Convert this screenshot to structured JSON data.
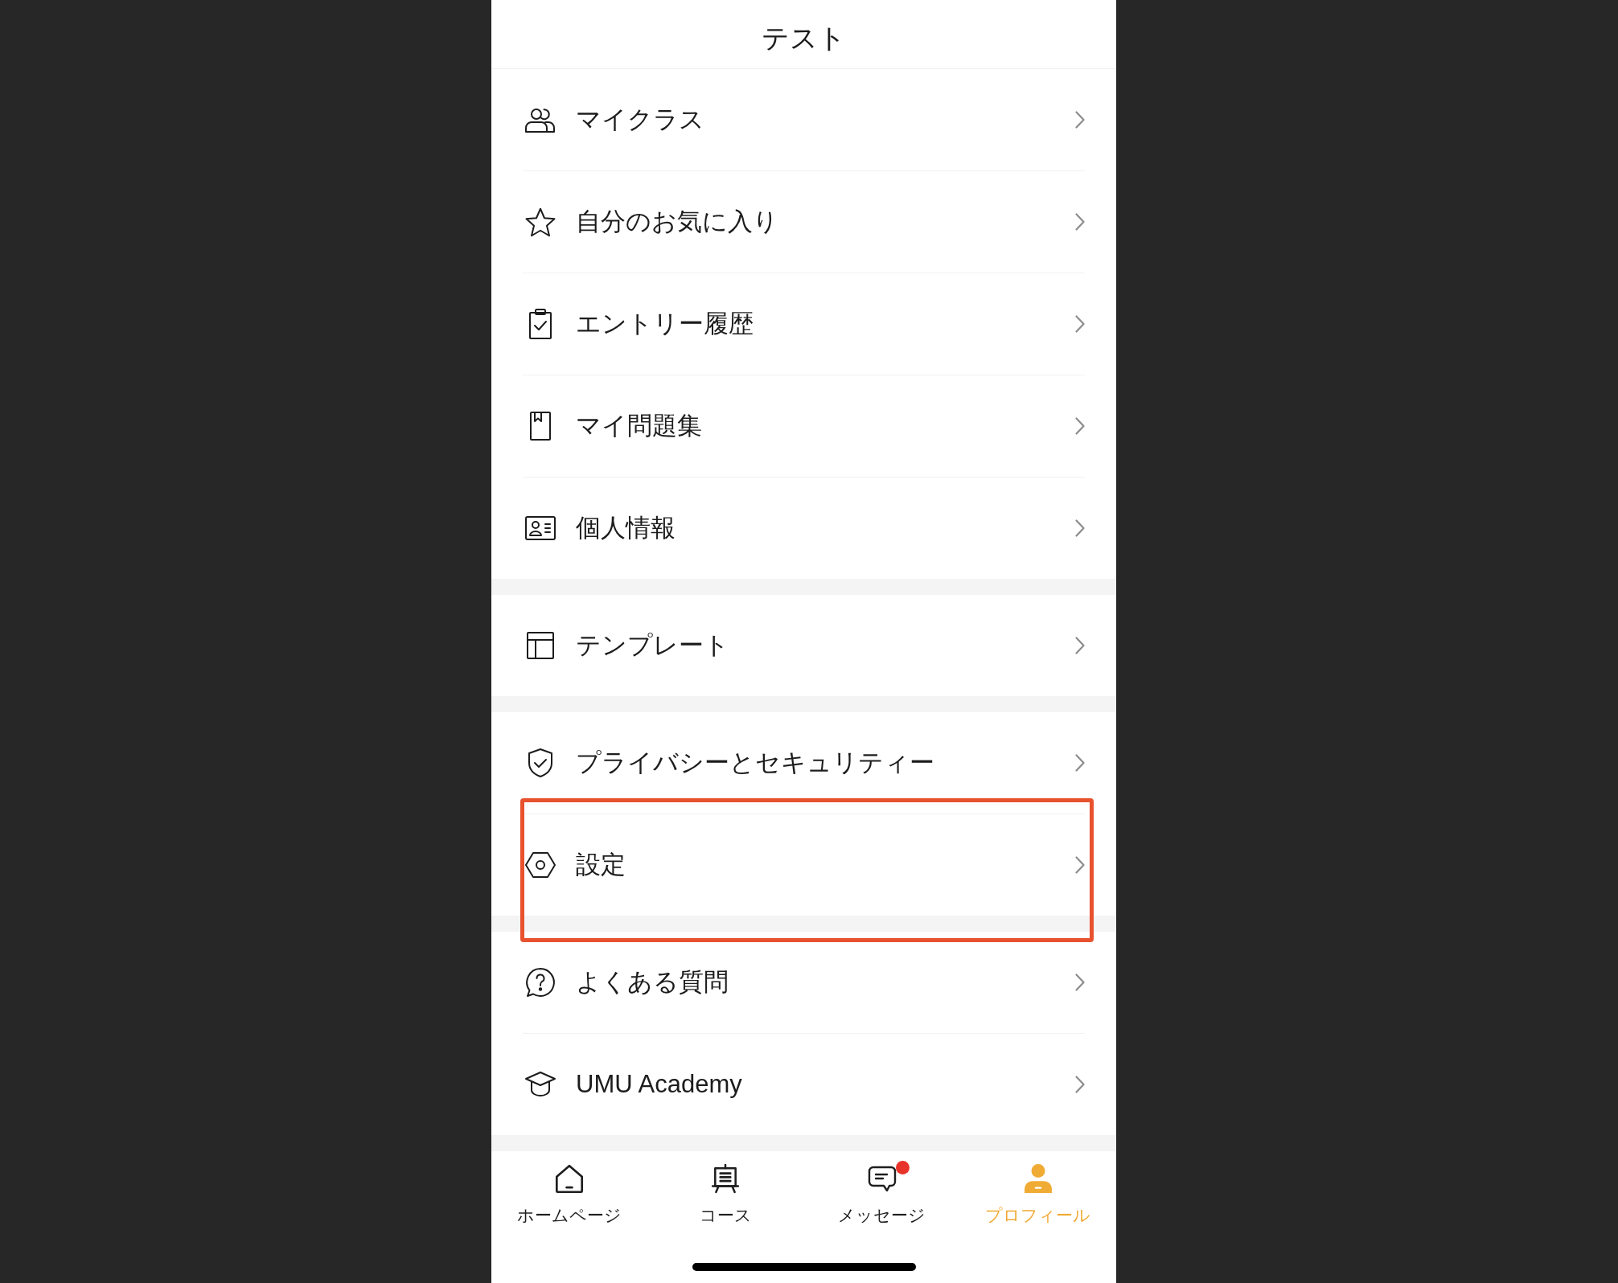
{
  "header": {
    "title": "テスト"
  },
  "menu_groups": [
    {
      "items": [
        {
          "label": "マイクラス",
          "highlighted": false
        },
        {
          "label": "自分のお気に入り",
          "highlighted": false
        },
        {
          "label": "エントリー履歴",
          "highlighted": false
        },
        {
          "label": "マイ問題集",
          "highlighted": false
        },
        {
          "label": "個人情報",
          "highlighted": false
        }
      ]
    },
    {
      "items": [
        {
          "label": "テンプレート",
          "highlighted": false
        }
      ]
    },
    {
      "items": [
        {
          "label": "プライバシーとセキュリティー",
          "highlighted": false
        },
        {
          "label": "設定",
          "highlighted": true
        }
      ]
    },
    {
      "items": [
        {
          "label": "よくある質問",
          "highlighted": false
        },
        {
          "label": "UMU Academy",
          "highlighted": false
        }
      ]
    }
  ],
  "tab_bar": [
    {
      "label": "ホームページ",
      "selected": false,
      "unread": false
    },
    {
      "label": "コース",
      "selected": false,
      "unread": false
    },
    {
      "label": "メッセージ",
      "selected": false,
      "unread": true
    },
    {
      "label": "プロフィール",
      "selected": true,
      "unread": false
    }
  ]
}
